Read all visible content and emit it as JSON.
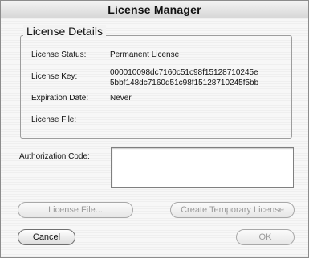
{
  "window": {
    "title": "License Manager"
  },
  "details": {
    "group_title": "License Details",
    "status_label": "License Status:",
    "status_value": "Permanent License",
    "key_label": "License Key:",
    "key_line1": "000010098dc7160c51c98f15128710245e",
    "key_line2": "5bbf148dc7160d51c98f15128710245f5bb",
    "expiration_label": "Expiration Date:",
    "expiration_value": "Never",
    "file_label": "License File:",
    "file_value": ""
  },
  "auth": {
    "label": "Authorization Code:",
    "value": ""
  },
  "buttons": {
    "license_file": "License File...",
    "create_temp": "Create Temporary License",
    "cancel": "Cancel",
    "ok": "OK"
  }
}
